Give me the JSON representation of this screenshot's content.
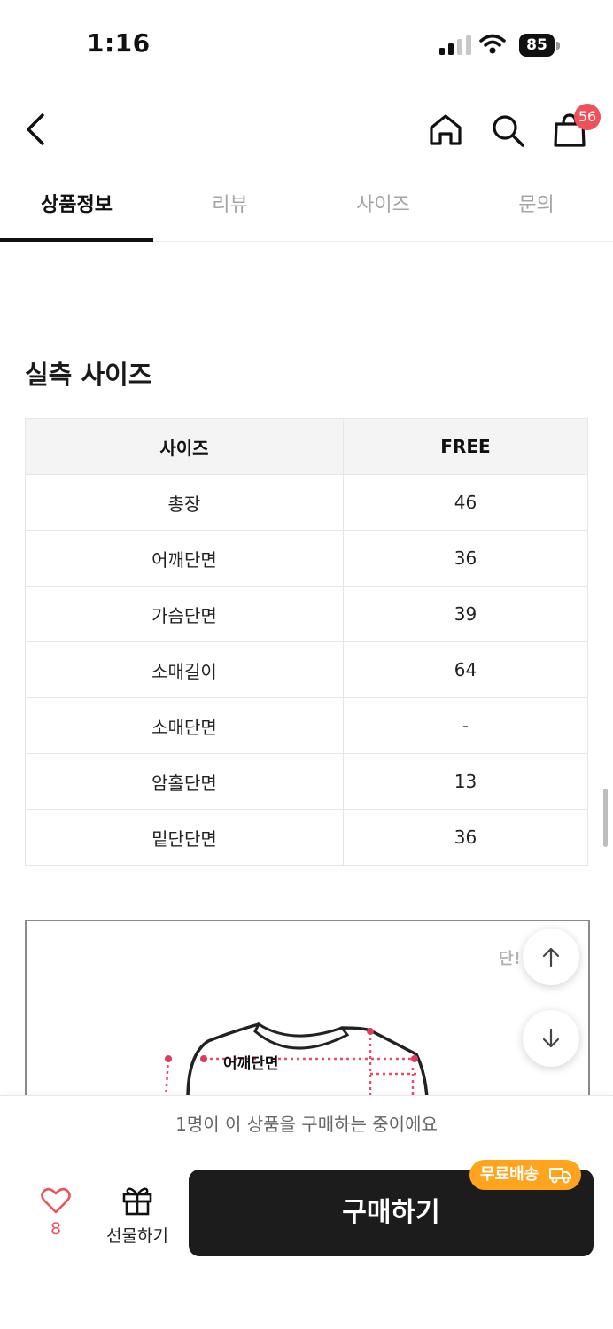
{
  "status": {
    "time": "1:16",
    "battery": "85"
  },
  "nav": {
    "cart_count": "56"
  },
  "tabs": [
    {
      "label": "상품정보",
      "active": true
    },
    {
      "label": "리뷰",
      "active": false
    },
    {
      "label": "사이즈",
      "active": false
    },
    {
      "label": "문의",
      "active": false
    }
  ],
  "section": {
    "title": "실측 사이즈"
  },
  "size_table": {
    "headers": [
      "사이즈",
      "FREE"
    ],
    "rows": [
      [
        "총장",
        "46"
      ],
      [
        "어깨단면",
        "36"
      ],
      [
        "가슴단면",
        "39"
      ],
      [
        "소매길이",
        "64"
      ],
      [
        "소매단면",
        "-"
      ],
      [
        "암홀단면",
        "13"
      ],
      [
        "밑단단면",
        "36"
      ]
    ]
  },
  "image": {
    "corner_text": "단!",
    "shoulder_label": "어깨단면"
  },
  "banner": {
    "text": "1명이 이 상품을 구매하는 중이에요"
  },
  "bottom_bar": {
    "like_count": "8",
    "gift_label": "선물하기",
    "buy_label": "구매하기",
    "shipping_badge": "무료배송"
  },
  "colors": {
    "accent": "#f0505b",
    "shipping": "#ffa41c",
    "buy_button": "#1c1c1c"
  }
}
